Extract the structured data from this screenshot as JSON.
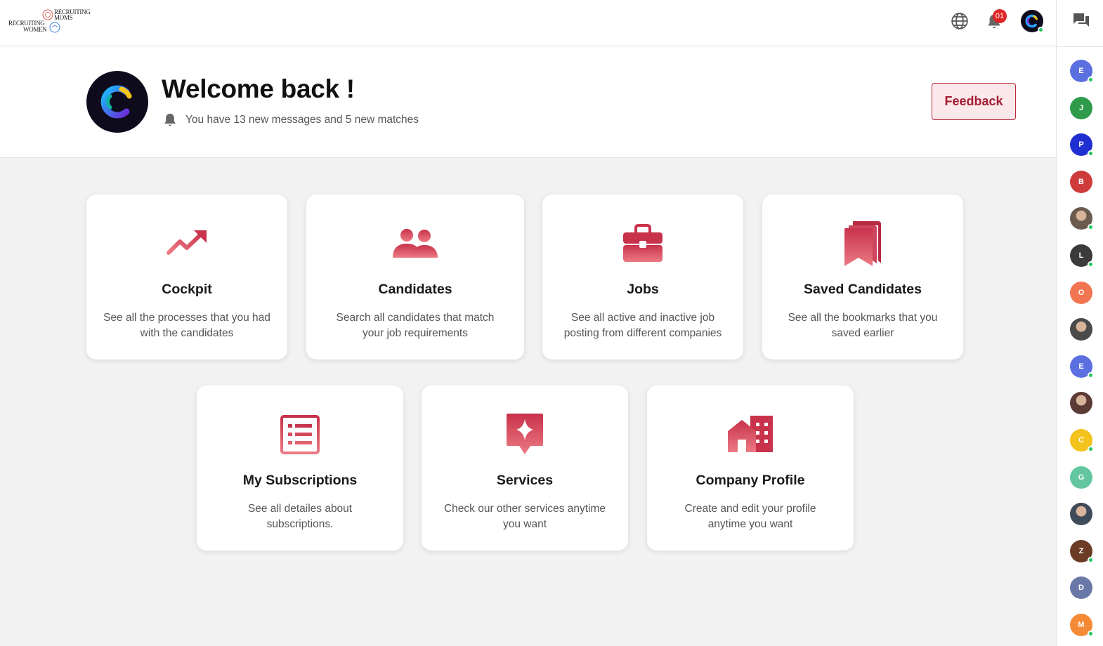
{
  "logo": {
    "line1": "RECRUITING",
    "line2": "MOMS",
    "line3": "RECRUITING",
    "line4": "WOMEN"
  },
  "header": {
    "notification_count": "01"
  },
  "welcome": {
    "title": "Welcome back !",
    "subtitle": "You have 13 new messages and 5 new matches",
    "feedback_label": "Feedback"
  },
  "cards": [
    {
      "title": "Cockpit",
      "desc1": "See all the processes that you had",
      "desc2": "with the candidates",
      "icon": "trending-up-icon"
    },
    {
      "title": "Candidates",
      "desc1": "Search all candidates that match",
      "desc2": "your job requirements",
      "icon": "users-icon"
    },
    {
      "title": "Jobs",
      "desc1": "See all active and inactive job",
      "desc2": "posting from different companies",
      "icon": "briefcase-icon"
    },
    {
      "title": "Saved Candidates",
      "desc1": "See all the bookmarks that you",
      "desc2": "saved earlier",
      "icon": "bookmarks-icon"
    },
    {
      "title": "My Subscriptions",
      "desc1": "See all detailes about",
      "desc2": "subscriptions.",
      "icon": "list-icon"
    },
    {
      "title": "Services",
      "desc1": "Check our other services anytime",
      "desc2": "you want",
      "icon": "sparkle-badge-icon"
    },
    {
      "title": "Company Profile",
      "desc1": "Create and edit your profile",
      "desc2": "anytime you want",
      "icon": "buildings-icon"
    }
  ],
  "contacts": [
    {
      "initial": "E",
      "color": "#5b6fe0",
      "online": true
    },
    {
      "initial": "J",
      "color": "#2e9b4a",
      "online": false
    },
    {
      "initial": "P",
      "color": "#1f2fd1",
      "online": true
    },
    {
      "initial": "B",
      "color": "#cf3b3b",
      "online": false
    },
    {
      "initial": "",
      "color": "#6b5a4e",
      "online": true,
      "photo": true
    },
    {
      "initial": "L",
      "color": "#3b3b3b",
      "online": true
    },
    {
      "initial": "O",
      "color": "#f27552",
      "online": false
    },
    {
      "initial": "",
      "color": "#4a4a4a",
      "online": false,
      "photo": true
    },
    {
      "initial": "E",
      "color": "#5b6fe0",
      "online": true
    },
    {
      "initial": "",
      "color": "#5c3a36",
      "online": false,
      "photo": true
    },
    {
      "initial": "C",
      "color": "#f3c21c",
      "online": true
    },
    {
      "initial": "G",
      "color": "#63c6a1",
      "online": false
    },
    {
      "initial": "",
      "color": "#3f4a5a",
      "online": false,
      "photo": true
    },
    {
      "initial": "Z",
      "color": "#6b3b26",
      "online": true
    },
    {
      "initial": "D",
      "color": "#6a78a8",
      "online": false
    },
    {
      "initial": "M",
      "color": "#f58a36",
      "online": true
    }
  ],
  "colors": {
    "accent": "#d44a5e",
    "feedback_border": "#b8283c",
    "feedback_bg": "#fbe8ea",
    "badge": "#e02424",
    "online": "#22c55e"
  }
}
